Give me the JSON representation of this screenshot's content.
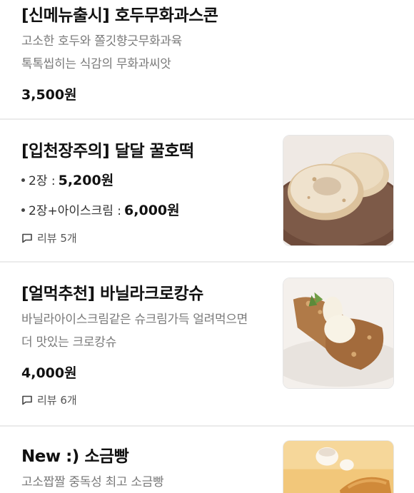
{
  "items": [
    {
      "title": "[신메뉴출시] 호두무화과스콘",
      "desc_lines": [
        "고소한 호두와 쫄깃향긋무화과육",
        "톡톡씹히는 식감의 무화과씨앗"
      ],
      "price": "3,500원"
    },
    {
      "title": "[입천장주의] 달달 꿀호떡",
      "options": [
        {
          "label": "2장 :",
          "price": "5,200원"
        },
        {
          "label": "2장+아이스크림 :",
          "price": "6,000원"
        }
      ],
      "review": "리뷰 5개"
    },
    {
      "title": "[얼먹추천] 바닐라크로캉슈",
      "desc_lines": [
        "바닐라아이스크림같은 슈크림가득 얼려먹으면",
        "더 맛있는 크로캉슈"
      ],
      "price": "4,000원",
      "review": "리뷰 6개"
    },
    {
      "title": "New :) 소금빵",
      "desc_lines": [
        "고소짭짤 중독성 최고 소금빵"
      ]
    }
  ],
  "icons": {
    "review": "speech-bubble-icon",
    "hotteok_photo": "hotteok-photo",
    "crocanshu_photo": "crocanshu-photo",
    "saltbread_photo": "salt-bread-photo"
  },
  "colors": {
    "title": "#111111",
    "desc": "#7a7a7a",
    "divider": "#ebebeb"
  }
}
